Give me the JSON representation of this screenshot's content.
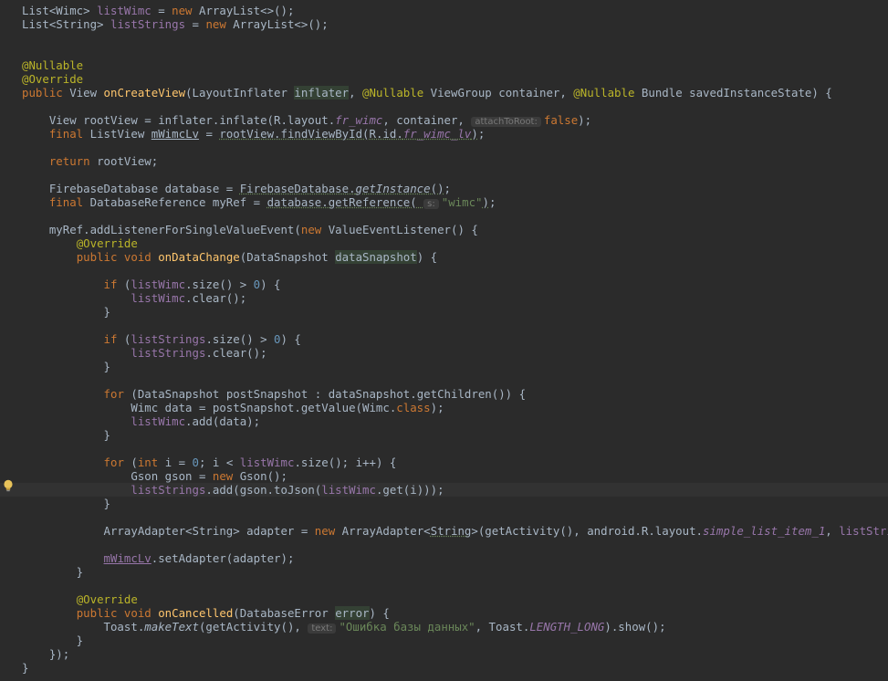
{
  "colors": {
    "background": "#2b2b2b",
    "text": "#a9b7c6",
    "keyword": "#cc7832",
    "annotation": "#bbb529",
    "method": "#ffc66d",
    "field": "#9876aa",
    "string": "#6a8759",
    "number": "#6897bb"
  },
  "icons": {
    "gutter": "lightbulb-icon"
  },
  "code": {
    "l01": {
      "t1": "List<Wimc> ",
      "f1": "listWimc",
      "t2": " = ",
      "k1": "new",
      "t3": " ArrayList<>();"
    },
    "l02": {
      "t1": "List<String> ",
      "f1": "listStrings",
      "t2": " = ",
      "k1": "new",
      "t3": " ArrayList<>();"
    },
    "l03": {
      "a1": "@Nullable"
    },
    "l04": {
      "a1": "@Override"
    },
    "l05": {
      "k1": "public",
      "t1": " View ",
      "m1": "onCreateView",
      "t2": "(LayoutInflater ",
      "p1": "inflater",
      "t3": ", ",
      "a1": "@Nullable",
      "t4": " ViewGroup container, ",
      "a2": "@Nullable",
      "t5": " Bundle savedInstanceState) {"
    },
    "l06": {
      "t1": "    View rootView = inflater.inflate(R.layout.",
      "f1": "fr_wimc",
      "t2": ", container, ",
      "h1": "attachToRoot:",
      "k1": "false",
      "t3": ");"
    },
    "l07": {
      "t0": "    ",
      "k1": "final",
      "t1": " ListView ",
      "v1": "mWimcLv",
      "t2": " = ",
      "w1": "rootView.findViewById(R.id.",
      "wf1": "fr_wimc_lv",
      "w2": ")",
      "t3": ";"
    },
    "l08": {
      "t0": "    ",
      "k1": "return",
      "t1": " rootView;"
    },
    "l09": {
      "t1": "    FirebaseDatabase database = ",
      "w1": "FirebaseDatabase.",
      "wi1": "getInstance",
      "w2": "()",
      "t2": ";"
    },
    "l10": {
      "t0": "    ",
      "k1": "final",
      "t1": " DatabaseReference myRef = ",
      "w1": "database.getReference( ",
      "h1": "s:",
      "s1": "\"wimc\"",
      "w2": ")",
      "t2": ";"
    },
    "l11": {
      "t1": "    myRef.addListenerForSingleValueEvent(",
      "k1": "new",
      "t2": " ValueEventListener() {"
    },
    "l12": {
      "t0": "        ",
      "a1": "@Override"
    },
    "l13": {
      "t0": "        ",
      "k1": "public void",
      "t1": " ",
      "m1": "onDataChange",
      "t2": "(DataSnapshot ",
      "p1": "dataSnapshot",
      "t3": ") {"
    },
    "l14": {
      "t0": "            ",
      "k1": "if",
      "t1": " (",
      "f1": "listWimc",
      "t2": ".size() > ",
      "n1": "0",
      "t3": ") {"
    },
    "l15": {
      "t0": "                ",
      "f1": "listWimc",
      "t1": ".clear();"
    },
    "l16": {
      "t1": "            }"
    },
    "l17": {
      "t0": "            ",
      "k1": "if",
      "t1": " (",
      "f1": "listStrings",
      "t2": ".size() > ",
      "n1": "0",
      "t3": ") {"
    },
    "l18": {
      "t0": "                ",
      "f1": "listStrings",
      "t1": ".clear();"
    },
    "l19": {
      "t1": "            }"
    },
    "l20": {
      "t0": "            ",
      "k1": "for",
      "t1": " (DataSnapshot postSnapshot : dataSnapshot.getChildren()) {"
    },
    "l21": {
      "t1": "                Wimc data = postSnapshot.getValue(Wimc.",
      "k1": "class",
      "t2": ");"
    },
    "l22": {
      "t0": "                ",
      "f1": "listWimc",
      "t1": ".add(data);"
    },
    "l23": {
      "t1": "            }"
    },
    "l24": {
      "t0": "            ",
      "k1": "for",
      "t1": " (",
      "k2": "int",
      "t2": " i = ",
      "n1": "0",
      "t3": "; i < ",
      "f1": "listWimc",
      "t4": ".size(); i++) {"
    },
    "l25": {
      "t1": "                Gson gson = ",
      "k1": "new",
      "t2": " Gson();"
    },
    "l26": {
      "t0": "                ",
      "f1": "listStrings",
      "t1": ".add(gson.toJson(",
      "f2": "listWimc",
      "t2": ".get(i)));"
    },
    "l27": {
      "t1": "            }"
    },
    "l28": {
      "t1": "            ArrayAdapter<String> adapter = ",
      "k1": "new",
      "t2": " ArrayAdapter<",
      "w1": "String",
      "t3": ">(getActivity(), android.R.layout.",
      "fi1": "simple_list_item_1",
      "t4": ", ",
      "f1": "listStrings",
      "t5": ");"
    },
    "l29": {
      "t0": "            ",
      "v1": "mWimcLv",
      "t1": ".setAdapter(adapter);"
    },
    "l30": {
      "t1": "        }"
    },
    "l31": {
      "t0": "        ",
      "a1": "@Override"
    },
    "l32": {
      "t0": "        ",
      "k1": "public void",
      "t1": " ",
      "m1": "onCancelled",
      "t2": "(DatabaseError ",
      "p1": "error",
      "t3": ") {"
    },
    "l33": {
      "t1": "            Toast.",
      "st1": "makeText",
      "t2": "(getActivity(), ",
      "h1": "text:",
      "s1": "\"Ошибка базы данных\"",
      "t3": ", Toast.",
      "fi1": "LENGTH_LONG",
      "t4": ").show();"
    },
    "l34": {
      "t1": "        }"
    },
    "l35": {
      "t1": "    });"
    },
    "l36": {
      "t1": "}"
    }
  }
}
